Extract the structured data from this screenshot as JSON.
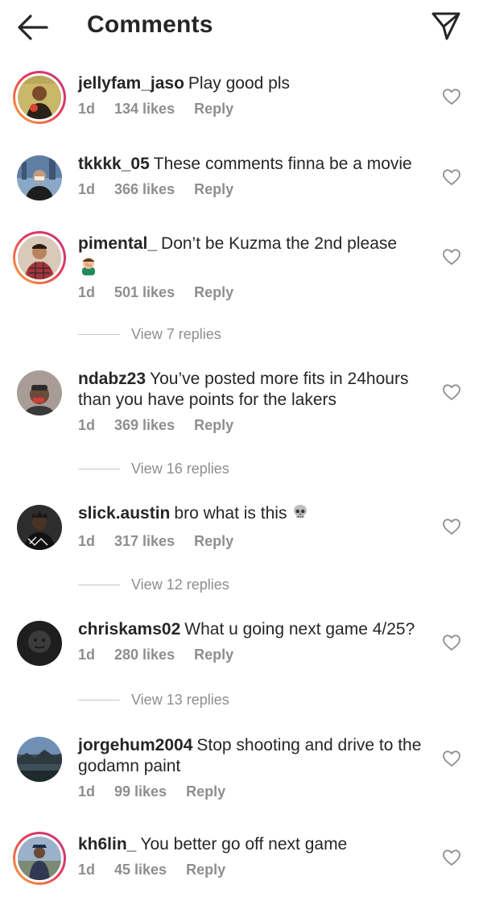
{
  "header": {
    "title": "Comments",
    "back_icon": "arrow-left-icon",
    "share_icon": "paper-plane-icon"
  },
  "colors": {
    "text": "#262626",
    "secondary": "#8e8e8e",
    "story_ring_start": "#f9a93b",
    "story_ring_end": "#c13584"
  },
  "comments": [
    {
      "username": "jellyfam_jaso",
      "text": "Play good pls",
      "time": "1d",
      "likes": "134 likes",
      "reply": "Reply"
    },
    {
      "username": "tkkkk_05",
      "text": "These comments finna be a movie",
      "time": "1d",
      "likes": "366 likes",
      "reply": "Reply"
    },
    {
      "username": "pimental_",
      "text": "Don’t be Kuzma the 2nd please",
      "emoji": "🤦‍♂️",
      "time": "1d",
      "likes": "501 likes",
      "reply": "Reply",
      "view_replies": "View 7 replies"
    },
    {
      "username": "ndabz23",
      "text": "You’ve posted more fits in 24hours than you have points for the lakers",
      "time": "1d",
      "likes": "369 likes",
      "reply": "Reply",
      "view_replies": "View 16 replies"
    },
    {
      "username": "slick.austin",
      "text": "bro what is this",
      "emoji": "💀",
      "time": "1d",
      "likes": "317 likes",
      "reply": "Reply",
      "view_replies": "View 12 replies"
    },
    {
      "username": "chriskams02",
      "text": "What u going next game 4/25?",
      "time": "1d",
      "likes": "280 likes",
      "reply": "Reply",
      "view_replies": "View 13 replies"
    },
    {
      "username": "jorgehum2004",
      "text": "Stop shooting and drive to the godamn paint",
      "time": "1d",
      "likes": "99 likes",
      "reply": "Reply"
    },
    {
      "username": "kh6lin_",
      "text": "You better go off next game",
      "time": "1d",
      "likes": "45 likes",
      "reply": "Reply"
    }
  ]
}
